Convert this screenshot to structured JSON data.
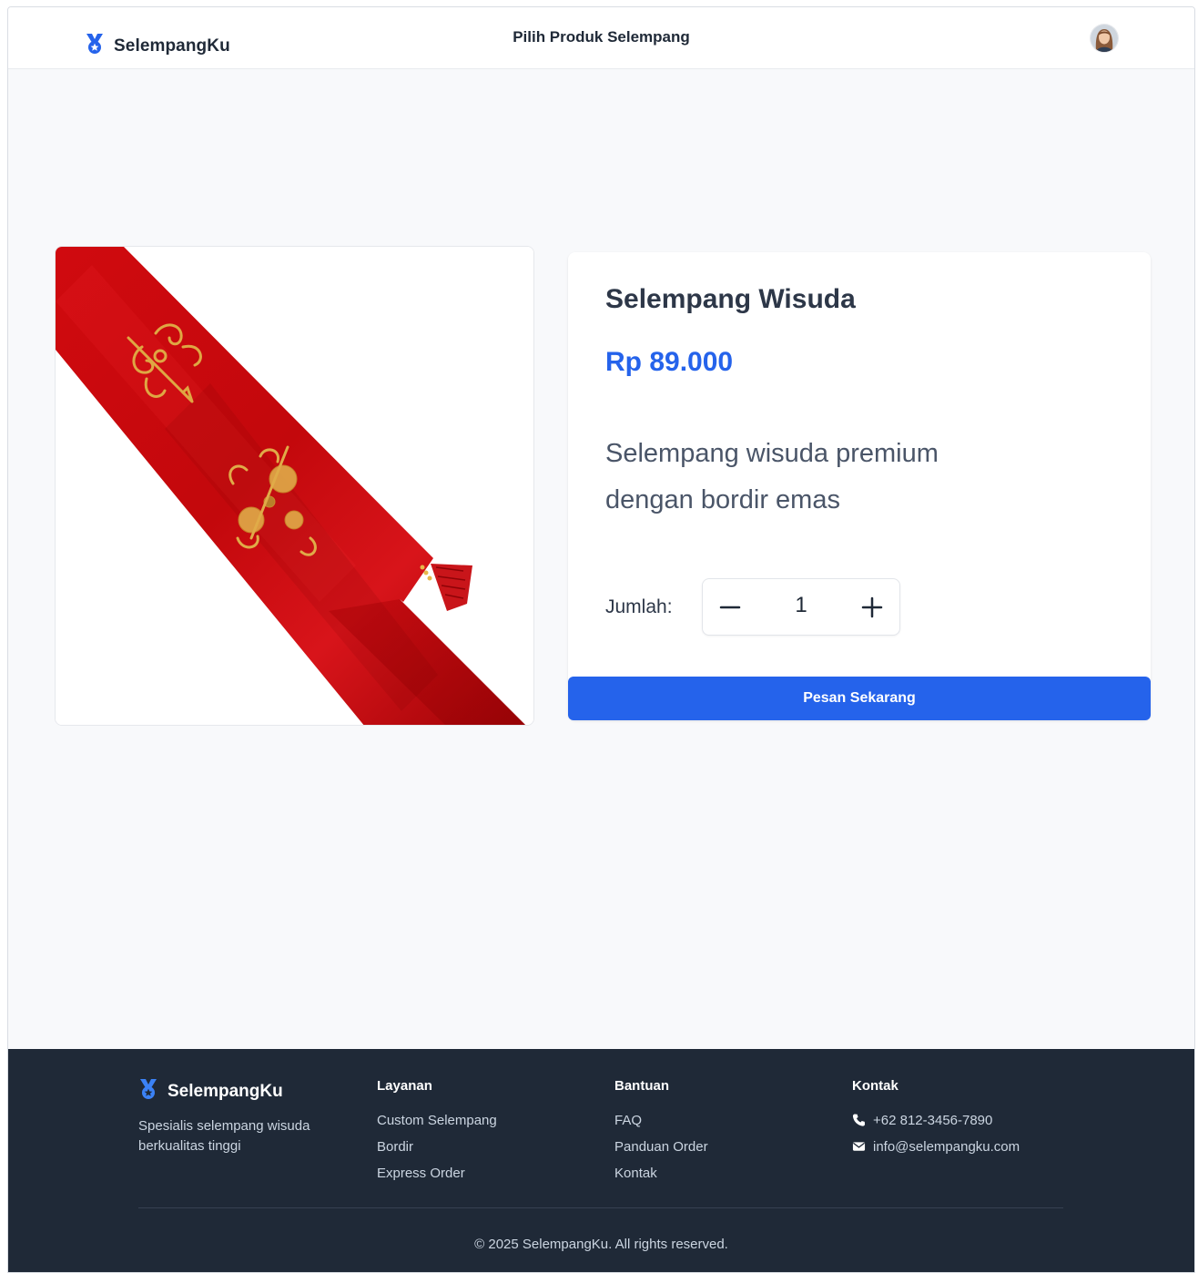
{
  "header": {
    "brand": "SelempangKu",
    "title": "Pilih Produk Selempang",
    "logo_icon": "medal-icon",
    "avatar_icon": "user-avatar"
  },
  "product": {
    "image_icon": "red-sash-image",
    "name": "Selempang Wisuda",
    "price": "Rp 89.000",
    "description": "Selempang wisuda premium dengan bordir emas",
    "quantity_label": "Jumlah:",
    "quantity": "1",
    "order_button": "Pesan Sekarang"
  },
  "footer": {
    "brand": "SelempangKu",
    "tagline": "Spesialis selempang wisuda berkualitas tinggi",
    "columns": [
      {
        "title": "Layanan",
        "items": [
          "Custom Selempang",
          "Bordir",
          "Express Order"
        ]
      },
      {
        "title": "Bantuan",
        "items": [
          "FAQ",
          "Panduan Order",
          "Kontak"
        ]
      }
    ],
    "contact": {
      "title": "Kontak",
      "phone": "+62 812-3456-7890",
      "email": "info@selempangku.com",
      "phone_icon": "phone-icon",
      "email_icon": "envelope-icon"
    },
    "copyright": "© 2025 SelempangKu. All rights reserved."
  },
  "colors": {
    "accent": "#2563eb",
    "footer_bg": "#1f2937",
    "page_bg": "#f8f9fb",
    "sash_red": "#c8080d",
    "embroidery_gold": "#d9a342"
  }
}
